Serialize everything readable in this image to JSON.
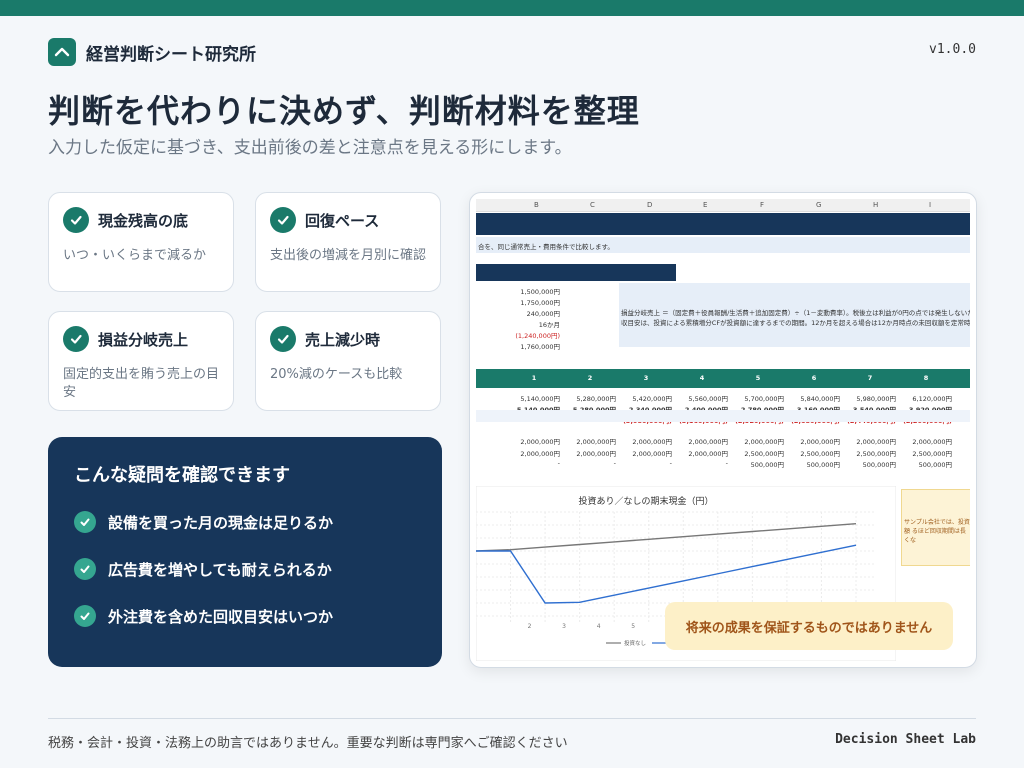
{
  "brand": {
    "name": "経営判断シート研究所",
    "version": "v1.0.0"
  },
  "hero": {
    "title": "判断を代わりに決めず、判断材料を整理",
    "subtitle": "入力した仮定に基づき、支出前後の差と注意点を見える形にします。"
  },
  "features": [
    {
      "title": "現金残高の底",
      "desc": "いつ・いくらまで減るか"
    },
    {
      "title": "回復ペース",
      "desc": "支出後の増減を月別に確認"
    },
    {
      "title": "損益分岐売上",
      "desc": "固定的支出を賄う売上の目安"
    },
    {
      "title": "売上減少時",
      "desc": "20%減のケースも比較"
    }
  ],
  "questions": {
    "title": "こんな疑問を確認できます",
    "items": [
      "設備を買った月の現金は足りるか",
      "広告費を増やしても耐えられるか",
      "外注費を含めた回収目安はいつか"
    ]
  },
  "spreadsheet": {
    "columns": [
      "B",
      "C",
      "D",
      "E",
      "F",
      "G",
      "H",
      "I"
    ],
    "intro": "合を、同じ通常売上・費用条件で比較します。",
    "inputs": [
      "1,500,000円",
      "1,750,000円",
      "240,000円",
      "16か月",
      "(1,240,000円)",
      "1,760,000円"
    ],
    "explain1": "損益分岐売上 ＝（固定費＋役員報酬/生活費＋追加固定費）÷（1－変動費率）。税後立は利益が0円の点では発生しないため同",
    "explain2": "収目安は、投資による累積増分CFが投資額に達するまでの期間。12か月を超える場合は12か月時点の未回収額を定常時の月次増分",
    "months": [
      "1",
      "2",
      "3",
      "4",
      "5",
      "6",
      "7",
      "8"
    ],
    "row1": [
      "5,140,000円",
      "5,280,000円",
      "5,420,000円",
      "5,560,000円",
      "5,700,000円",
      "5,840,000円",
      "5,980,000円",
      "6,120,000円"
    ],
    "row2": [
      "5,140,000円",
      "5,280,000円",
      "2,340,000円",
      "2,400,000円",
      "2,780,000円",
      "3,160,000円",
      "3,540,000円",
      "3,920,000円"
    ],
    "row3": [
      "-",
      "-",
      "(3,080,000円)",
      "(3,160,000円)",
      "(2,920,000円)",
      "(2,680,000円)",
      "(2,440,000円)",
      "(2,200,000円)"
    ],
    "row4": [
      "2,000,000円",
      "2,000,000円",
      "2,000,000円",
      "2,000,000円",
      "2,000,000円",
      "2,000,000円",
      "2,000,000円",
      "2,000,000円"
    ],
    "row5": [
      "2,000,000円",
      "2,000,000円",
      "2,000,000円",
      "2,000,000円",
      "2,500,000円",
      "2,500,000円",
      "2,500,000円",
      "2,500,000円"
    ],
    "row6": [
      "-",
      "-",
      "-",
      "-",
      "500,000円",
      "500,000円",
      "500,000円",
      "500,000円"
    ],
    "note": "サンプル会社では、投資額 るほど回収期間は長くな"
  },
  "chart_data": {
    "type": "line",
    "title": "投資あり／なしの期末現金（円）",
    "x": [
      "1",
      "2",
      "3",
      "4",
      "5",
      "6",
      "7",
      "8",
      "9",
      "10",
      "11",
      "12"
    ],
    "series": [
      {
        "name": "投資なし",
        "color": "#777777",
        "values": [
          100,
          102,
          106,
          110,
          114,
          118,
          122,
          126,
          130,
          134,
          138,
          142
        ]
      },
      {
        "name": "投資あり",
        "color": "#2f6fd0",
        "values": [
          100,
          100,
          20,
          21,
          32,
          43,
          54,
          65,
          76,
          87,
          98,
          109
        ]
      }
    ],
    "xtick_labels_visible": [
      "2",
      "3",
      "4",
      "5",
      "6",
      "7"
    ],
    "legend": [
      "投資なし",
      "投"
    ],
    "grid": true
  },
  "disclaimer": "将来の成果を保証するものではありません",
  "footer": {
    "left": "税務・会計・投資・法務上の助言ではありません。重要な判断は専門家へご確認ください",
    "right": "Decision Sheet Lab"
  }
}
